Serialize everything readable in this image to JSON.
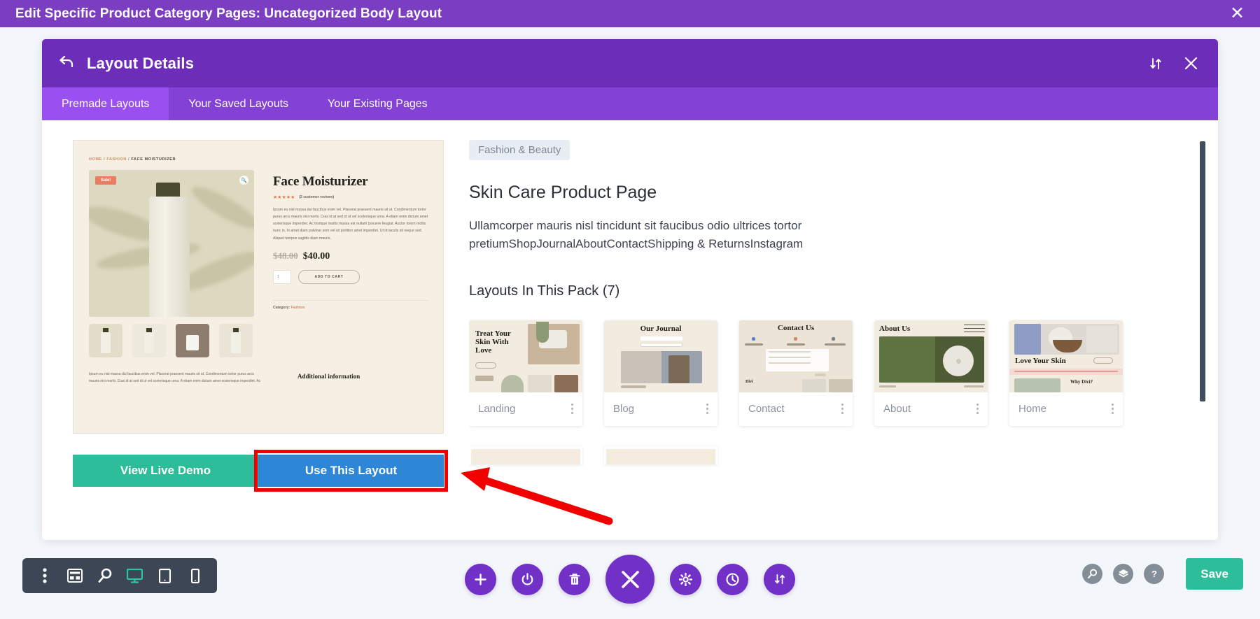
{
  "admin_bar": {
    "title": "Edit Specific Product Category Pages: Uncategorized Body Layout",
    "close_label": "✕"
  },
  "modal": {
    "title": "Layout Details",
    "back_icon": "back-arrow-icon",
    "sort_icon": "sort-up-down-icon",
    "close_icon": "close-icon",
    "tabs": [
      {
        "label": "Premade Layouts",
        "active": true
      },
      {
        "label": "Your Saved Layouts",
        "active": false
      },
      {
        "label": "Your Existing Pages",
        "active": false
      }
    ]
  },
  "preview": {
    "breadcrumb": {
      "home": "HOME",
      "sep1": "/",
      "category": "FASHION",
      "sep2": "/",
      "current": "FACE MOISTURIZER"
    },
    "sale_badge": "Sale!",
    "magnify_icon": "magnify-icon",
    "product_title": "Face Moisturizer",
    "stars": "★★★★★",
    "reviews": "(2 customer reviews)",
    "description": "Ipsum eu nisl massa dui faucibus enim vel. Placerat praesent mauris sit ut. Condimentum tortor purus arcu mauris nisi morbi. Cras id at sed id ut vel scelerisque urna. A etiam enim dictum amet scelerisque imperdiet. Ac tristique mattis massa est nullam posuere feugiat. Auctor lorem mollis nunc in. In amet diam pulvinar sem vel sit porttitor amet imperdiet. Ut id iaculis sit neque sed. Aliquet tempus sagittis diam mauris.",
    "price_old": "$48.00",
    "price_new": "$40.00",
    "quantity": "1",
    "add_to_cart": "ADD TO CART",
    "category_label": "Category:",
    "category_value": "Fashion",
    "footer_text": "Ipsum eu nisl massa dui faucibus enim vel. Placerat praesent mauris sit ut. Condimentum tortor purus arcu mauris nisi morbi. Cras id at sed id ut vel scelerisque urna. A etiam enim dictum amet scelerisque imperdiet. Ac",
    "additional_information": "Additional information",
    "view_live_demo": "View Live Demo",
    "use_this_layout": "Use This Layout"
  },
  "detail": {
    "category_badge": "Fashion & Beauty",
    "pack_title": "Skin Care Product Page",
    "pack_description": "Ullamcorper mauris nisl tincidunt sit faucibus odio ultrices tortor pretiumShopJournalAboutContactShipping & ReturnsInstagram",
    "layouts_heading": "Layouts In This Pack (7)",
    "cards": [
      {
        "label": "Landing",
        "thumb_heading": "Treat Your Skin With Love",
        "menu_icon": "kebab-menu-icon"
      },
      {
        "label": "Blog",
        "thumb_heading": "Our Journal",
        "menu_icon": "kebab-menu-icon"
      },
      {
        "label": "Contact",
        "thumb_heading": "Contact Us",
        "menu_icon": "kebab-menu-icon"
      },
      {
        "label": "About",
        "thumb_heading": "About Us",
        "menu_icon": "kebab-menu-icon"
      },
      {
        "label": "Home",
        "thumb_heading": "Love Your Skin",
        "menu_icon": "kebab-menu-icon"
      }
    ],
    "contact_thumb": {
      "divi_label": "Divi"
    },
    "home_thumb": {
      "why_divi": "Why Divi?"
    },
    "scrollbar": "vertical-scrollbar"
  },
  "bottom_toolbar": {
    "left_icons": [
      {
        "name": "kebab-menu-icon",
        "active": false
      },
      {
        "name": "wireframe-icon",
        "active": false
      },
      {
        "name": "zoom-out-icon",
        "active": false
      },
      {
        "name": "desktop-icon",
        "active": true
      },
      {
        "name": "tablet-icon",
        "active": false
      },
      {
        "name": "phone-icon",
        "active": false
      }
    ],
    "center_icons": [
      {
        "name": "add-icon",
        "big": false
      },
      {
        "name": "power-icon",
        "big": false
      },
      {
        "name": "trash-icon",
        "big": false
      },
      {
        "name": "close-icon",
        "big": true
      },
      {
        "name": "gear-icon",
        "big": false
      },
      {
        "name": "history-icon",
        "big": false
      },
      {
        "name": "sort-up-down-icon",
        "big": false
      }
    ],
    "right_icons": [
      {
        "name": "search-icon"
      },
      {
        "name": "layers-icon"
      },
      {
        "name": "help-icon"
      }
    ],
    "save_label": "Save"
  },
  "annotation": {
    "arrow": "red-arrow-pointing-to-use-this-layout",
    "highlight": "red-rectangle-around-use-this-layout",
    "color": "#f20000"
  },
  "colors": {
    "admin_purple": "#7b3ec1",
    "modal_purple": "#6c2eb9",
    "tab_purple": "#8441d6",
    "tab_active": "#9a4ff0",
    "teal": "#2dbd9a",
    "blue": "#2d86d6",
    "toolbar_dark": "#3c4655"
  }
}
